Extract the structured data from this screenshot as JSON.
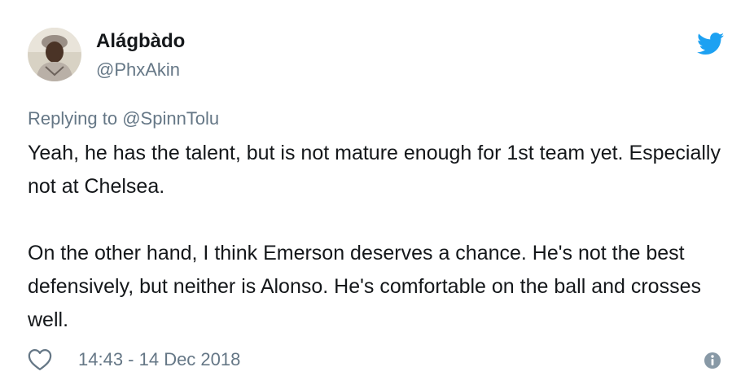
{
  "author": {
    "display_name": "Alágbàdo",
    "handle": "@PhxAkin",
    "avatar": "avatar-photo"
  },
  "brand": {
    "icon": "twitter-bird-icon",
    "color": "#1da1f2"
  },
  "reply": {
    "prefix": "Replying to",
    "mention": "@SpinnTolu"
  },
  "tweet": {
    "paragraphs": [
      "Yeah, he has the talent, but is not mature enough for 1st team yet. Especially not at Chelsea.",
      "On the other hand, I think Emerson deserves a chance. He's not the best defensively, but neither is Alonso. He's comfortable on the ball and crosses well."
    ]
  },
  "footer": {
    "like_icon": "heart-icon",
    "timestamp": "14:43 - 14 Dec 2018",
    "info_icon": "info-icon"
  },
  "colors": {
    "text": "#14171a",
    "secondary": "#657786"
  }
}
